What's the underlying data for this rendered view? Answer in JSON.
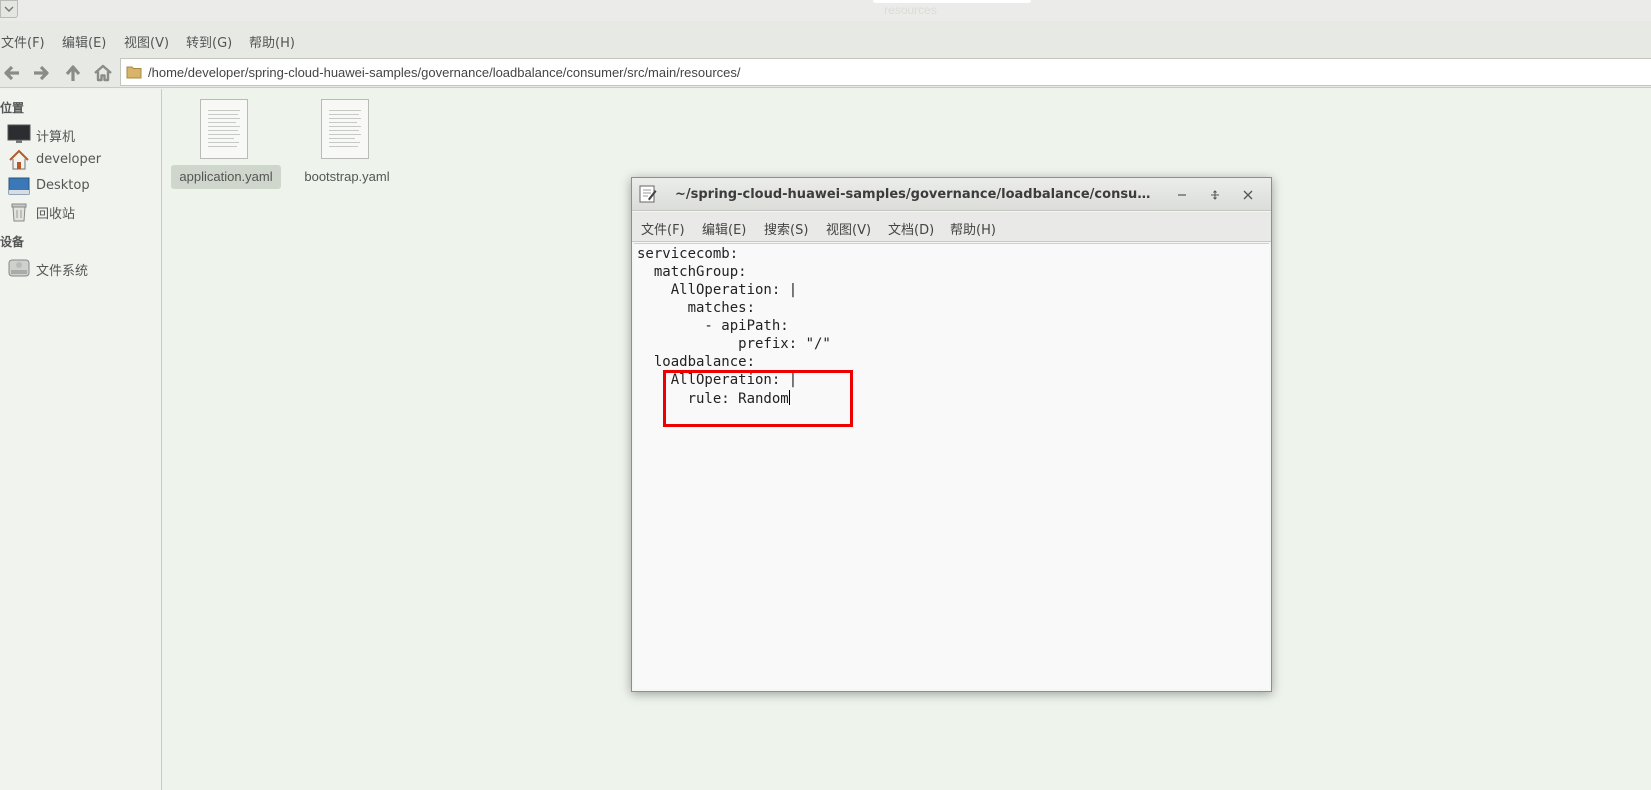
{
  "file_manager": {
    "title": "resources",
    "menu": [
      "文件(F)",
      "编辑(E)",
      "视图(V)",
      "转到(G)",
      "帮助(H)"
    ],
    "address": "/home/developer/spring-cloud-huawei-samples/governance/loadbalance/consumer/src/main/resources/",
    "sidebar": {
      "places_heading": "位置",
      "places": [
        "计算机",
        "developer",
        "Desktop",
        "回收站"
      ],
      "devices_heading": "设备",
      "devices": [
        "文件系统"
      ]
    },
    "files": [
      "application.yaml",
      "bootstrap.yaml"
    ]
  },
  "editor": {
    "title": "~/spring-cloud-huawei-samples/governance/loadbalance/consumer/s…",
    "menu": [
      "文件(F)",
      "编辑(E)",
      "搜索(S)",
      "视图(V)",
      "文档(D)",
      "帮助(H)"
    ],
    "lines": [
      "servicecomb:",
      "  matchGroup:",
      "    AllOperation: |",
      "      matches:",
      "        - apiPath:",
      "            prefix: \"/\"",
      "  loadbalance:",
      "    AllOperation: |",
      "      rule: Random"
    ]
  },
  "colors": {
    "highlight": "#ee0000"
  }
}
